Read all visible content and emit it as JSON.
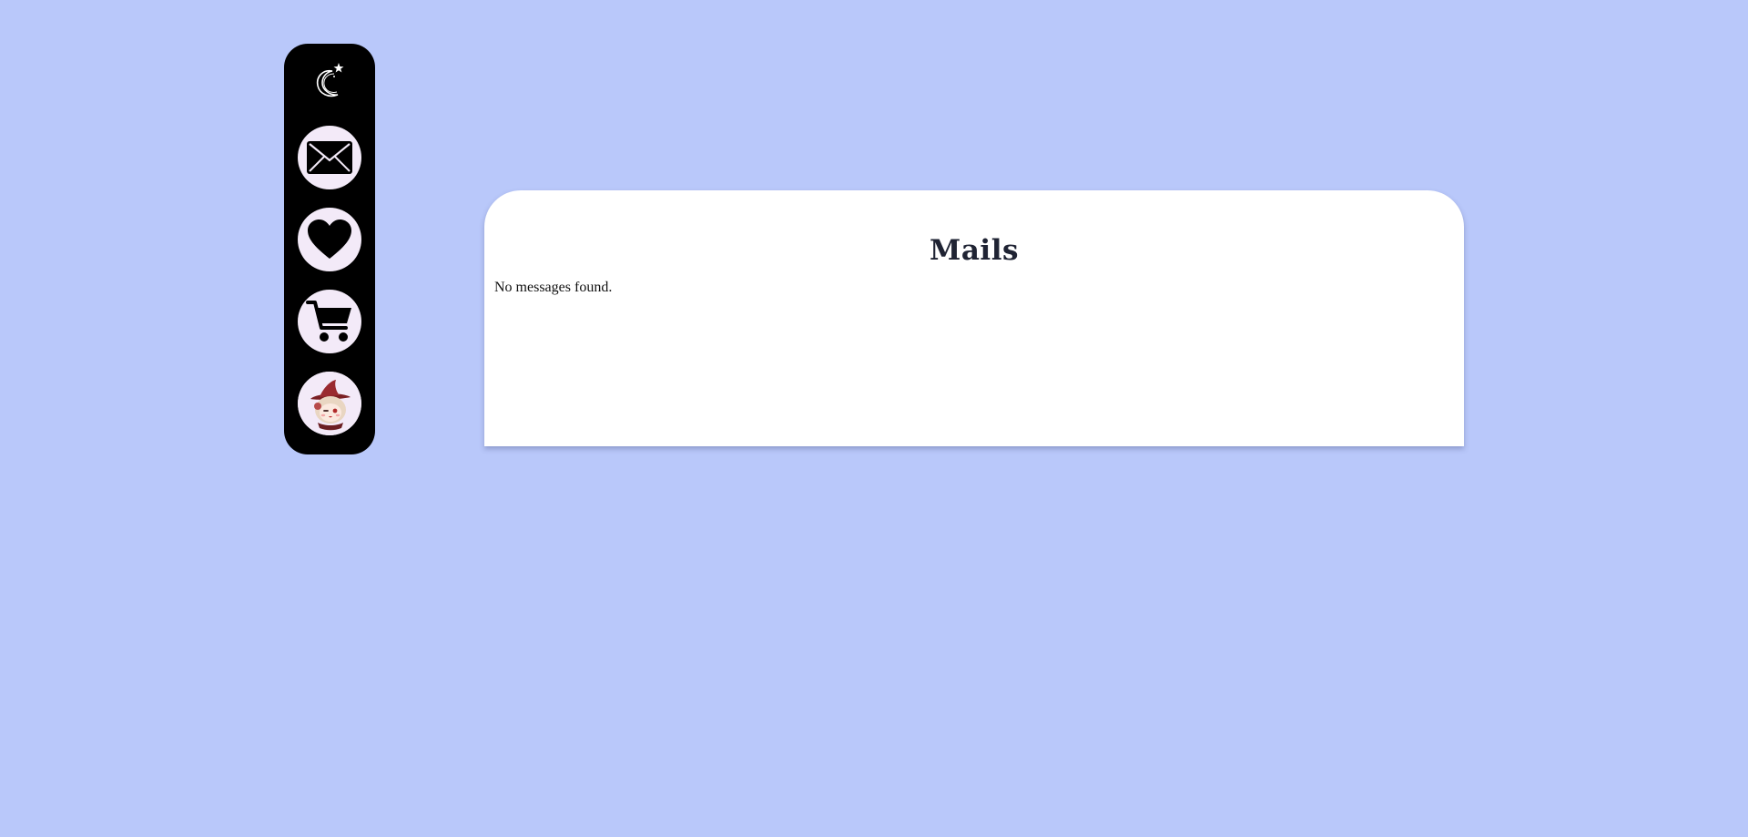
{
  "sidebar": {
    "logo_icon": "crescent-moon-star-logo",
    "items": [
      {
        "icon": "mail-icon"
      },
      {
        "icon": "heart-icon"
      },
      {
        "icon": "cart-icon"
      },
      {
        "icon": "avatar"
      }
    ]
  },
  "main": {
    "title": "Mails",
    "empty_message": "No messages found."
  },
  "colors": {
    "background": "#b9c8fa",
    "sidebar": "#000000",
    "button_bg": "#f3eaf8",
    "panel": "#ffffff"
  }
}
